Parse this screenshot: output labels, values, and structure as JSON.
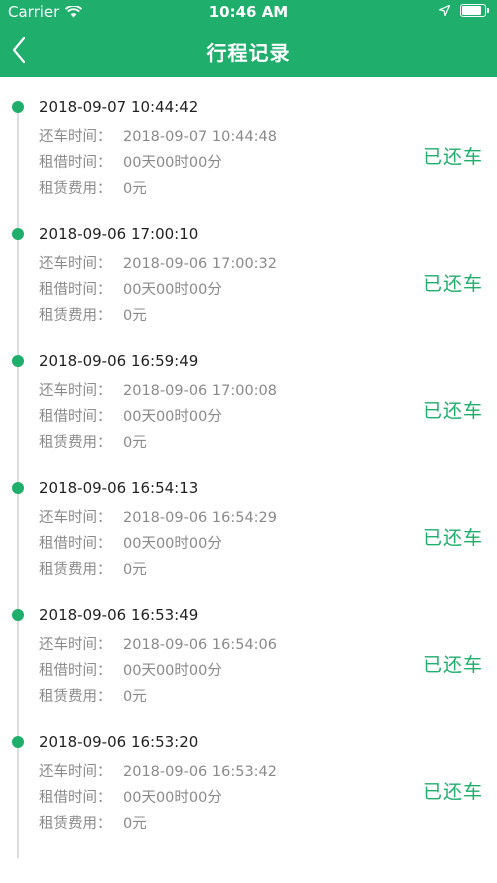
{
  "status_bar": {
    "carrier": "Carrier",
    "time": "10:46 AM",
    "battery_level": 0.9
  },
  "nav": {
    "title": "行程记录"
  },
  "labels": {
    "return_time": "还车时间：",
    "rent_duration": "租借时间：",
    "rent_fee": "租赁费用："
  },
  "records": [
    {
      "start": "2018-09-07 10:44:42",
      "return_time": "2018-09-07 10:44:48",
      "duration": "00天00时00分",
      "fee": "0元",
      "status": "已还车"
    },
    {
      "start": "2018-09-06 17:00:10",
      "return_time": "2018-09-06 17:00:32",
      "duration": "00天00时00分",
      "fee": "0元",
      "status": "已还车"
    },
    {
      "start": "2018-09-06 16:59:49",
      "return_time": "2018-09-06 17:00:08",
      "duration": "00天00时00分",
      "fee": "0元",
      "status": "已还车"
    },
    {
      "start": "2018-09-06 16:54:13",
      "return_time": "2018-09-06 16:54:29",
      "duration": "00天00时00分",
      "fee": "0元",
      "status": "已还车"
    },
    {
      "start": "2018-09-06 16:53:49",
      "return_time": "2018-09-06 16:54:06",
      "duration": "00天00时00分",
      "fee": "0元",
      "status": "已还车"
    },
    {
      "start": "2018-09-06 16:53:20",
      "return_time": "2018-09-06 16:53:42",
      "duration": "00天00时00分",
      "fee": "0元",
      "status": "已还车"
    }
  ],
  "colors": {
    "accent": "#1fae6c",
    "muted_text": "#8a8a8a",
    "timeline": "#dcdcdc"
  }
}
